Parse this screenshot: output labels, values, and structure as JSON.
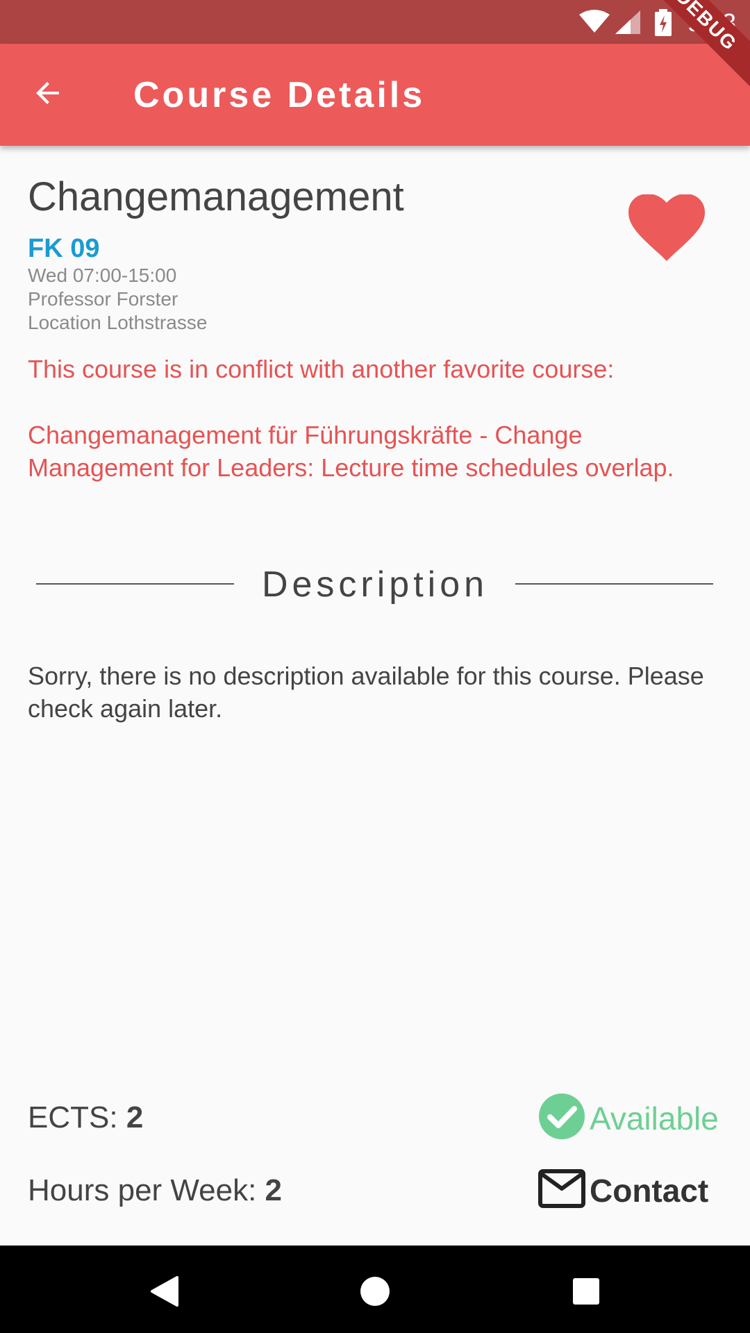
{
  "status_bar": {
    "time": "9:53",
    "icons": [
      "wifi-icon",
      "cell-signal-icon",
      "battery-charging-icon"
    ],
    "debug_label": "DEBUG"
  },
  "app_bar": {
    "back_icon": "arrow-left-icon",
    "title": "Course Details"
  },
  "course": {
    "title": "Changemanagement",
    "faculty": "FK 09",
    "schedule": "Wed 07:00-15:00",
    "professor": "Professor Forster",
    "location": "Location Lothstrasse",
    "favorite_icon": "heart-icon",
    "is_favorite": true,
    "conflict_message": "This course is in conflict with another favorite course:",
    "conflict_detail": "Changemanagement für Führungskräfte - Change Management for Leaders: Lecture time schedules overlap."
  },
  "description_section": {
    "heading": "Description",
    "text": "Sorry, there is no description available for this course. Please check again later."
  },
  "footer": {
    "ects_label": "ECTS:",
    "ects_value": "2",
    "hours_label": "Hours per Week:",
    "hours_value": "2",
    "availability_icon": "check-circle-icon",
    "availability_label": "Available",
    "contact_icon": "mail-icon",
    "contact_label": "Contact"
  },
  "nav_bar": {
    "back_icon": "nav-back-icon",
    "home_icon": "nav-home-icon",
    "recents_icon": "nav-recents-icon"
  },
  "colors": {
    "status_bar": "#ad4444",
    "app_bar": "#ec5a5a",
    "faculty": "#1b9bd1",
    "conflict": "#e65353",
    "heart": "#ec5a5a",
    "available": "#6ecf94",
    "background": "#fafafa"
  }
}
